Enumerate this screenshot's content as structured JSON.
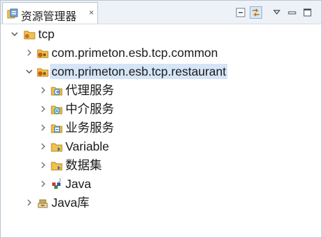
{
  "view": {
    "title": "资源管理器",
    "close_label": "×"
  },
  "toolbar": {
    "collapse_all_icon": "collapse-all-icon",
    "link_with_editor_icon": "link-with-editor-icon",
    "view_menu_icon": "view-menu-icon",
    "minimize_icon": "minimize-icon",
    "maximize_icon": "maximize-icon"
  },
  "tree": {
    "root": {
      "label": "tcp",
      "expanded": true
    },
    "projects": [
      {
        "label": "com.primeton.esb.tcp.common",
        "expanded": false
      },
      {
        "label": "com.primeton.esb.tcp.restaurant",
        "expanded": true,
        "selected": true
      }
    ],
    "children": [
      {
        "label": "代理服务",
        "icon": "proxy-service-folder-icon"
      },
      {
        "label": "中介服务",
        "icon": "mediation-service-folder-icon"
      },
      {
        "label": "业务服务",
        "icon": "business-service-folder-icon"
      },
      {
        "label": "Variable",
        "icon": "variable-folder-icon"
      },
      {
        "label": "数据集",
        "icon": "dataset-folder-icon"
      },
      {
        "label": "Java",
        "icon": "java-package-icon"
      }
    ],
    "library": {
      "label": "Java库",
      "expanded": false
    }
  },
  "colors": {
    "selection": "#d5e5f7",
    "folder": "#e9b84a",
    "border": "#b8c4d2"
  }
}
